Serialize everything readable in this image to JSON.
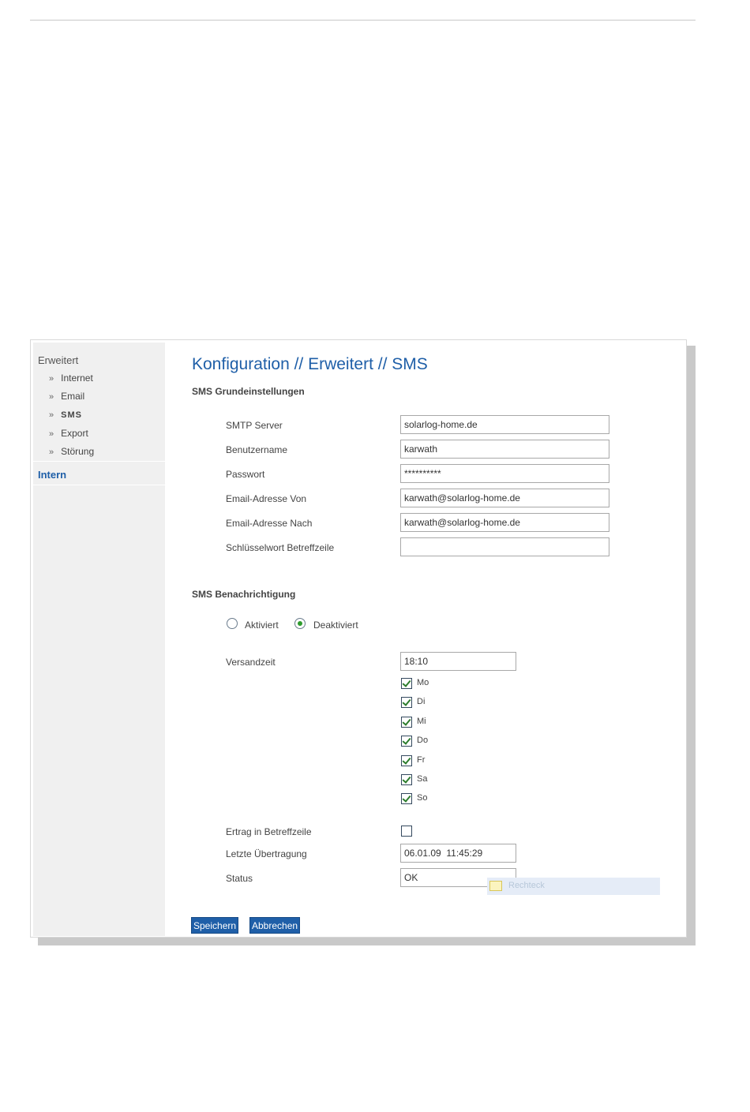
{
  "sidebar": {
    "group_erweitert": "Erweitert",
    "items": [
      {
        "arrow": "»",
        "label": "Internet"
      },
      {
        "arrow": "»",
        "label": "Email"
      },
      {
        "arrow": "»",
        "label": "SMS"
      },
      {
        "arrow": "»",
        "label": "Export"
      },
      {
        "arrow": "»",
        "label": "Störung"
      }
    ],
    "group_intern": "Intern"
  },
  "main": {
    "title": "Konfiguration // Erweitert // SMS",
    "section_basic": "SMS Grundeinstellungen",
    "fields": [
      {
        "label": "SMTP Server",
        "value": "solarlog-home.de"
      },
      {
        "label": "Benutzername",
        "value": "karwath"
      },
      {
        "label": "Passwort",
        "value": "**********"
      },
      {
        "label": "Email-Adresse Von",
        "value": "karwath@solarlog-home.de"
      },
      {
        "label": "Email-Adresse Nach",
        "value": "karwath@solarlog-home.de"
      },
      {
        "label": "Schlüsselwort Betreffzeile",
        "value": ""
      }
    ],
    "section_notify": "SMS Benachrichtigung",
    "radio_activated": "Aktiviert",
    "radio_deactivated": "Deaktiviert",
    "selected_radio": "Deaktiviert",
    "send_time_label": "Versandzeit",
    "send_time_value": "18:10",
    "days": [
      {
        "label": "Mo",
        "checked": true
      },
      {
        "label": "Di",
        "checked": true
      },
      {
        "label": "Mi",
        "checked": true
      },
      {
        "label": "Do",
        "checked": true
      },
      {
        "label": "Fr",
        "checked": true
      },
      {
        "label": "Sa",
        "checked": true
      },
      {
        "label": "So",
        "checked": true
      }
    ],
    "yield_label": "Ertrag in Betreffzeile",
    "yield_checked": false,
    "last_transfer_label": "Letzte Übertragung",
    "last_transfer_value": "06.01.09  11:45:29",
    "status_label": "Status",
    "status_value": "OK",
    "save_button": "Speichern",
    "cancel_button": "Abbrechen",
    "overlay_text": "Rechteck"
  }
}
